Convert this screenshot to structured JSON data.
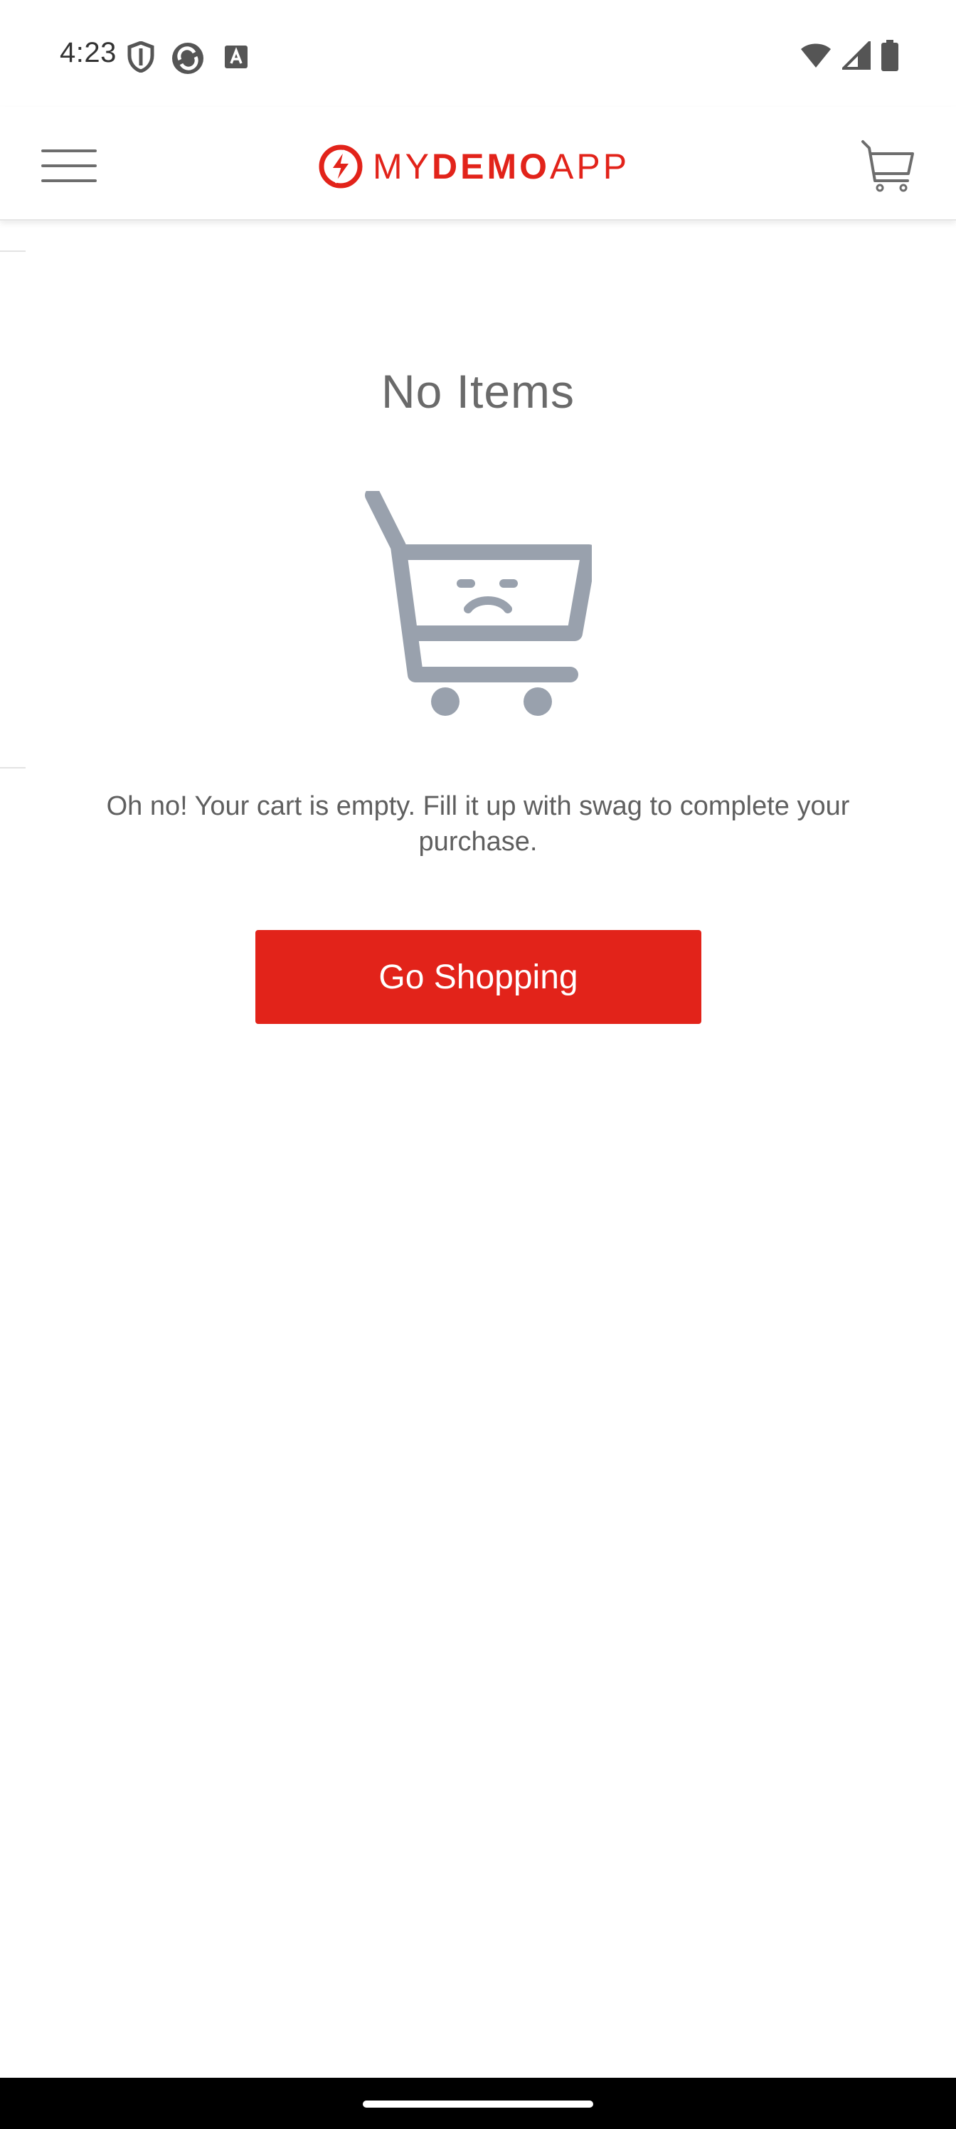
{
  "status_bar": {
    "time": "4:23",
    "icons_left": [
      "shield-icon",
      "sync-icon",
      "font-icon"
    ],
    "icons_right": [
      "wifi-icon",
      "signal-icon",
      "battery-icon"
    ]
  },
  "header": {
    "logo_text_my": "MY",
    "logo_text_demo": "DEMO",
    "logo_text_app": "APP",
    "menu_icon": "hamburger-menu-icon",
    "cart_icon": "cart-icon"
  },
  "main": {
    "title": "No Items",
    "illustration_icon": "sad-cart-icon",
    "message": "Oh no! Your cart is empty. Fill it up with swag to complete your purchase.",
    "button_label": "Go Shopping"
  },
  "colors": {
    "brand": "#e2231a",
    "illustration": "#99a1ad",
    "text": "#5f5f5f"
  }
}
